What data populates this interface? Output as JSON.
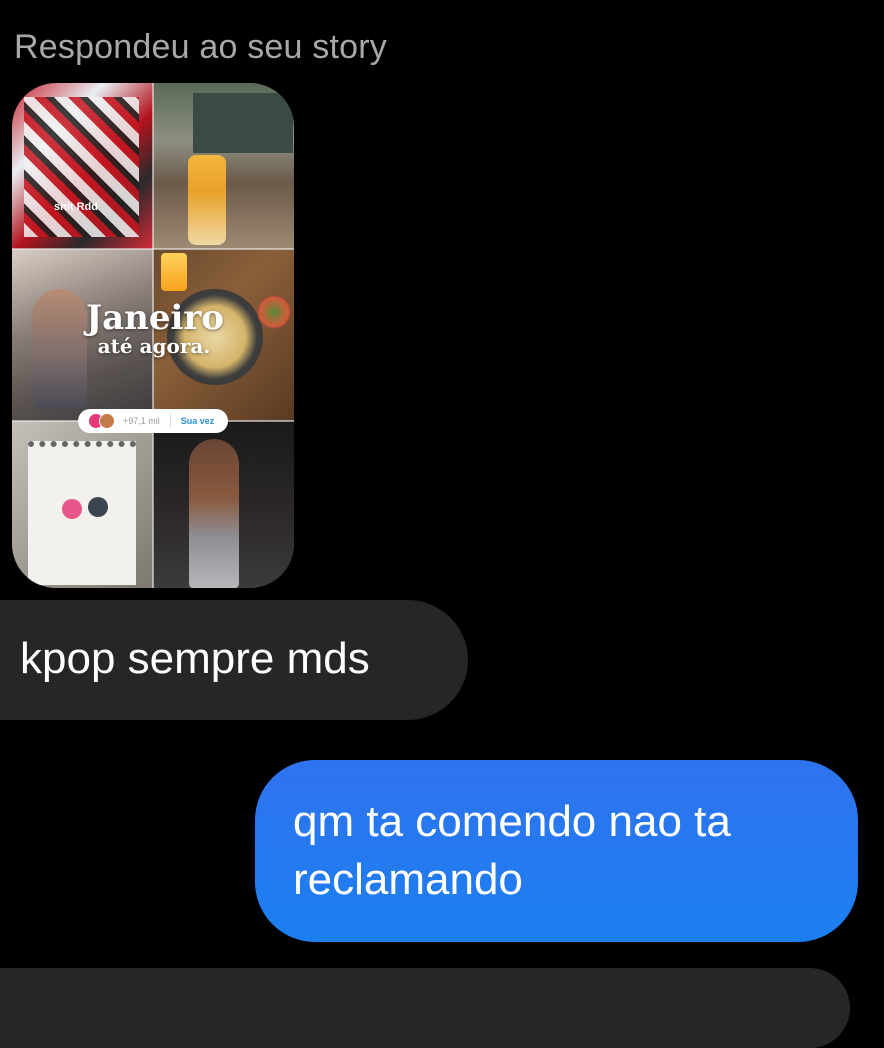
{
  "reply_context": {
    "label": "Respondeu ao seu story"
  },
  "story": {
    "title": "Janeiro",
    "subtitle": "até agora.",
    "tile_1_text": "shit Rdd",
    "viewer_count": "+97,1 mil",
    "cta_label": "Sua vez"
  },
  "messages": [
    {
      "direction": "incoming",
      "text": "kpop sempre mds"
    },
    {
      "direction": "outgoing",
      "text": "qm ta comendo nao ta reclamando"
    },
    {
      "direction": "incoming",
      "text": ""
    }
  ],
  "colors": {
    "background": "#000000",
    "incoming_bubble": "#262626",
    "outgoing_bubble": "#1c7ff0",
    "label_text": "#a8a8a8"
  }
}
